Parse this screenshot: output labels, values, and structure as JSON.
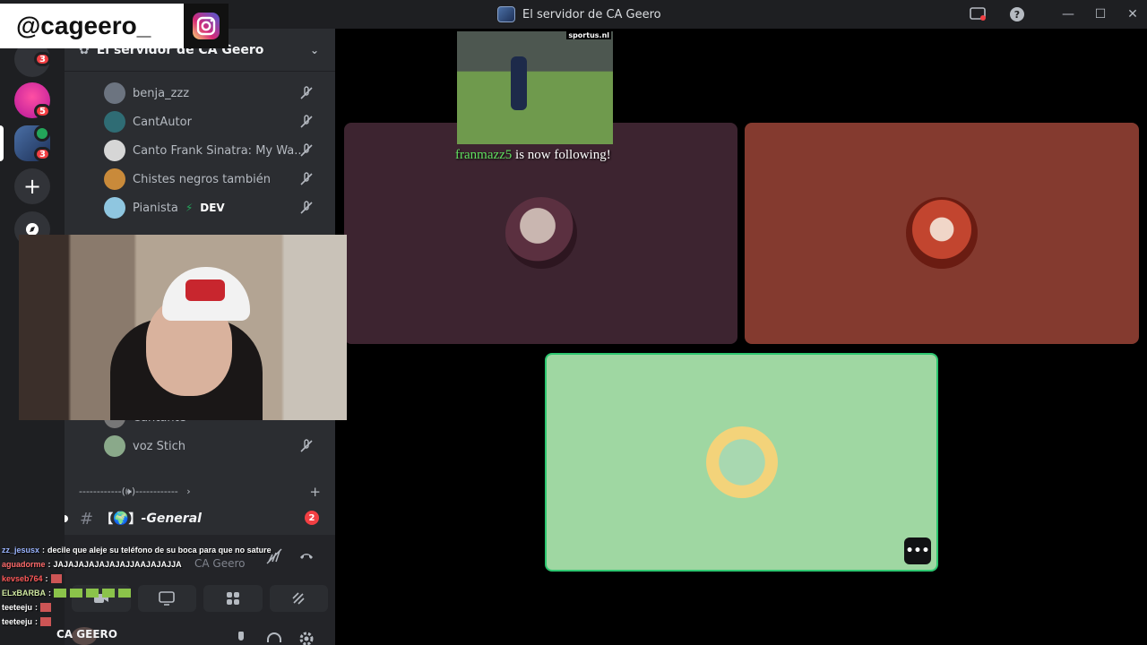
{
  "window": {
    "title": "El servidor de CA Geero"
  },
  "overlay": {
    "handle": "@cageero_",
    "follow_user": "franmazz5",
    "follow_text": "is now following!",
    "clip_watermark": "sportus.nl"
  },
  "rail": {
    "badges": [
      "3",
      "5",
      "3"
    ]
  },
  "sidebar": {
    "server_name": "El servidor de CA Geero",
    "voice_users": [
      {
        "name": "benja_zzz"
      },
      {
        "name": "CantAutor"
      },
      {
        "name": "Canto Frank Sinatra: My Wa..."
      },
      {
        "name": "Chistes negros también"
      },
      {
        "name": "Pianista",
        "tag": "DEV"
      },
      {
        "name": "Cantante"
      },
      {
        "name": "voz Stich"
      }
    ],
    "category_divider": "------------(🕪)------------",
    "channel": {
      "prefix": "【",
      "emoji": "🌍",
      "suffix": "】",
      "name": "-General",
      "badge": "2"
    },
    "voice_status": {
      "channel_hint": "CA Geero"
    },
    "user": {
      "name": "CA GEERO"
    }
  },
  "chat": [
    {
      "user": "zz_jesusx",
      "color": "#9ab4ff",
      "msg": "decile que aleje su teléfono de su boca para que no sature"
    },
    {
      "user": "aguadorme",
      "color": "#ff6b6b",
      "msg": "JAJAJAJAJAJAJAJJAAJAJAJJA"
    },
    {
      "user": "kevseb764",
      "color": "#ff5a5a",
      "msg": ""
    },
    {
      "user": "ELxBARBA",
      "color": "#cfe8a0",
      "msg": ""
    },
    {
      "user": "teeteeju",
      "color": "#ffffff",
      "msg": ""
    },
    {
      "user": "teeteeju",
      "color": "#ffffff",
      "msg": ""
    }
  ],
  "colors": {
    "tile1": "#3d2430",
    "tile2": "#843a2f",
    "tile3": "#9fd7a2",
    "speaking": "#2dc770",
    "notif": "#f23f43"
  }
}
